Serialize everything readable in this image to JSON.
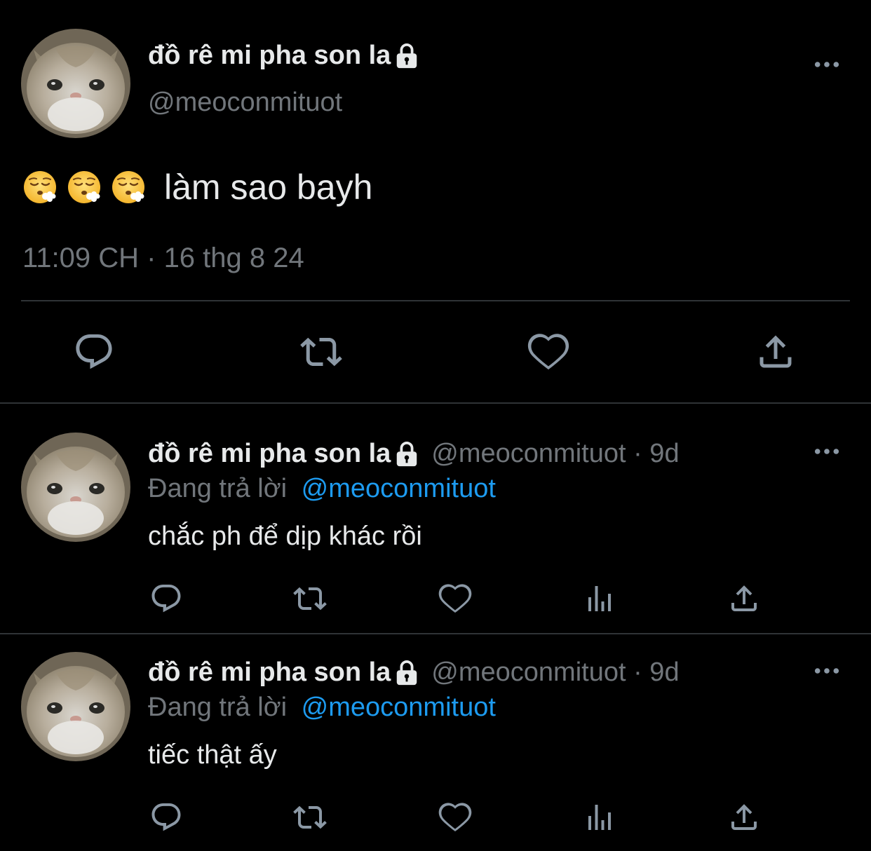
{
  "main_tweet": {
    "display_name": "đồ rê mi pha son la",
    "handle": "@meoconmituot",
    "text": "làm sao bayh",
    "emojis": [
      "face-exhaling",
      "face-exhaling",
      "face-exhaling"
    ],
    "timestamp": "11:09 CH · 16 thg 8 24",
    "actions": [
      "reply-icon",
      "retweet-icon",
      "like-icon",
      "share-icon"
    ]
  },
  "replies": [
    {
      "display_name": "đồ rê mi pha son la",
      "handle_time": "@meoconmituot · 9d",
      "replying_label": "Đang trả lời",
      "replying_to": "@meoconmituot",
      "text": "chắc ph để dịp khác rồi",
      "actions": [
        "reply-icon",
        "retweet-icon",
        "like-icon",
        "views-icon",
        "share-icon"
      ]
    },
    {
      "display_name": "đồ rê mi pha son la",
      "handle_time": "@meoconmituot · 9d",
      "replying_label": "Đang trả lời",
      "replying_to": "@meoconmituot",
      "text": "tiếc thật ấy",
      "actions": [
        "reply-icon",
        "retweet-icon",
        "like-icon",
        "views-icon",
        "share-icon"
      ]
    }
  ],
  "colors": {
    "background": "#000000",
    "text": "#e7e9ea",
    "muted": "#71767b",
    "link": "#1d9bf0",
    "divider": "#2f3336"
  }
}
